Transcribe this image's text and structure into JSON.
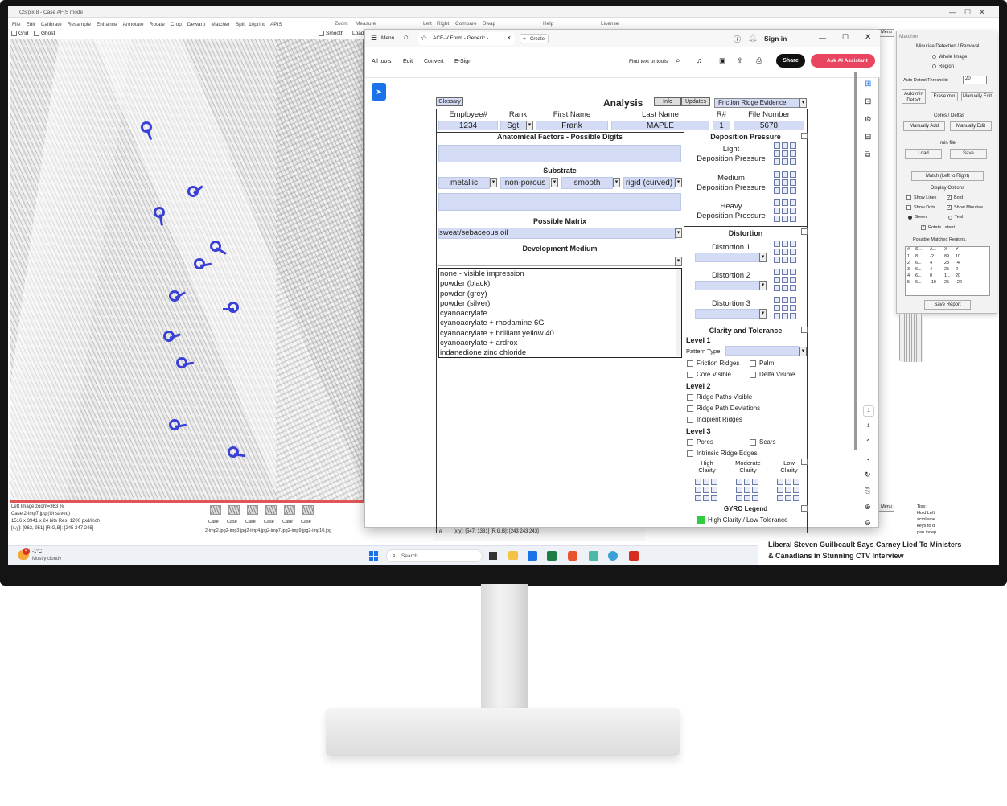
{
  "cslip": {
    "title": "CSlpix 8 - Case AFIS mode",
    "menu": [
      "File",
      "Edit",
      "Calibrate",
      "Resample",
      "Enhance",
      "Annotate",
      "Rotate",
      "Crop",
      "Dewarp",
      "Matcher",
      "Split_10print",
      "APIS"
    ],
    "menu_right": [
      "Zoom",
      "Measure"
    ],
    "menu_right2": [
      "Left",
      "Right",
      "Compare",
      "Swap"
    ],
    "menu_help": "Help",
    "menu_license": "License",
    "toolbar": {
      "grid": "Grid",
      "ghost": "Ghost",
      "smooth": "Smooth",
      "load": "Load"
    },
    "status": {
      "line1": "Left Image   zoom=363 %",
      "line2": "Case 2-imp7.jpg (Unsaved)",
      "line3": "1516 x 3941 x 24 bits    Res: 1200 pxd/inch",
      "line4": "[x,y]: [962, 951]    [R,G,B]: [245 247 245]"
    },
    "thumb_labels": [
      "Case",
      "Case",
      "Case",
      "Case",
      "Case",
      "Case"
    ],
    "thumb_files": "2-imp2.jpg2-imp3.jpg2-imp4.jpg2-imp7.jpg2-imp9.jpg2-imp10.jpg",
    "right_status": {
      "row": "6",
      "coords": "[x,y]: [547, 1381]    [R,G,B]: [243 243 243]"
    }
  },
  "acrobat": {
    "menu_label": "Menu",
    "tab_title": "ACE-V Form - Generic - ...",
    "create": "Create",
    "sign_in": "Sign in",
    "tools": [
      "All tools",
      "Edit",
      "Convert",
      "E-Sign"
    ],
    "find": "Find text or tools",
    "share": "Share",
    "ai": "Ask AI Assistant",
    "page_num": "1",
    "page_total": "1"
  },
  "form": {
    "glossary": "Glossary",
    "title": "Analysis",
    "info": "Info",
    "updates": "Updates",
    "evidence": "Friction Ridge Evidence",
    "headers": [
      "Employee#",
      "Rank",
      "First Name",
      "Last Name",
      "R#",
      "File Number"
    ],
    "values": {
      "employee": "1234",
      "rank": "Sgt.",
      "first": "Frank",
      "last": "MAPLE",
      "r": "1",
      "file": "5678"
    },
    "anatomical": "Anatomical Factors - Possible Digits",
    "substrate": "Substrate",
    "substrate_vals": [
      "metallic",
      "non-porous",
      "smooth",
      "rigid (curved)"
    ],
    "matrix": "Possible Matrix",
    "matrix_val": "sweat/sebaceous oil",
    "dev_medium": "Development Medium",
    "dev_list": [
      "none - visible impression",
      "powder (black)",
      "powder (grey)",
      "powder (silver)",
      "cyanoacrylate",
      "cyanoacrylate + rhodamine 6G",
      "cyanoacrylate + brilliant yellow 40",
      "cyanoacrylate + ardrox",
      "indanedione zinc chloride"
    ],
    "deposition": "Deposition Pressure",
    "dep_light": [
      "Light",
      "Deposition Pressure"
    ],
    "dep_medium": [
      "Medium",
      "Deposition Pressure"
    ],
    "dep_heavy": [
      "Heavy",
      "Deposition Pressure"
    ],
    "distortion": "Distortion",
    "dist": [
      "Distortion 1",
      "Distortion 2",
      "Distortion 3"
    ],
    "clarity": "Clarity and Tolerance",
    "level1": "Level 1",
    "pattern": "Pattern Type:",
    "l1_boxes": [
      "Friction Ridges",
      "Palm",
      "Core Visible",
      "Delta Visible"
    ],
    "level2": "Level 2",
    "l2_boxes": [
      "Ridge Paths Visible",
      "Ridge Path Deviations",
      "Incipient Ridges"
    ],
    "level3": "Level 3",
    "l3_boxes": [
      "Pores",
      "Scars",
      "Intrinsic Ridge Edges"
    ],
    "clar_cols": [
      [
        "High",
        "Clarity"
      ],
      [
        "Moderate",
        "Clarity"
      ],
      [
        "Low",
        "Clarity"
      ]
    ],
    "gyro": "GYRO Legend",
    "gyro_high": "High Clarity / Low Tolerance",
    "green": "#2ecc40"
  },
  "matcher": {
    "title": "Matcher",
    "section1": "Minutiae Detection / Removal",
    "whole": "Whole Image",
    "region": "Region",
    "threshold": "Auto Detect Threshold:",
    "threshold_val": "20",
    "auto_min": "Auto min Detect",
    "erase_min": "Erase min",
    "manual_edit": "Manually Edit",
    "cores": "Cores / Deltas",
    "manually_add": "Manually Add",
    "manually_edit2": "Manually Edit",
    "min_file": "min file",
    "load": "Load",
    "save": "Save",
    "match": "Match (Left to Right)",
    "display": "Display Options",
    "show_lines": "Show Lines",
    "bold": "Bold",
    "show_dots": "Show Dots",
    "show_minutiae": "Show Minutiae",
    "green": "Green",
    "teal": "Teal",
    "rotate_latent": "Rotate Latent",
    "possible": "Possible Matched Regions.",
    "table_head": [
      "#",
      "S...",
      "A...",
      "X",
      "Y"
    ],
    "table_rows": [
      [
        "1",
        "8...",
        "-2",
        "89",
        "10"
      ],
      [
        "2",
        "6...",
        "4",
        "23",
        "-4"
      ],
      [
        "3",
        "6...",
        "4",
        "25",
        "2"
      ],
      [
        "4",
        "6...",
        "0",
        "1...",
        "20"
      ],
      [
        "5",
        "6...",
        "-10",
        "25",
        "-22"
      ]
    ],
    "save_report": "Save Report",
    "menu_btn": "Menu",
    "tips": "Tips:",
    "tips_text": [
      "Hold Left",
      "scrollwhe",
      "keys to d",
      "pan indep"
    ]
  },
  "news": {
    "line1": "Liberal Steven Guilbeault Says Carney Lied To Ministers",
    "line2": "& Canadians in Stunning CTV Interview"
  },
  "taskbar": {
    "temp": "-1°C",
    "weather": "Mostly cloudy",
    "badge": "4",
    "search": "Search"
  },
  "accent": "#1a73e8",
  "marker_color": "#3a3fd6"
}
